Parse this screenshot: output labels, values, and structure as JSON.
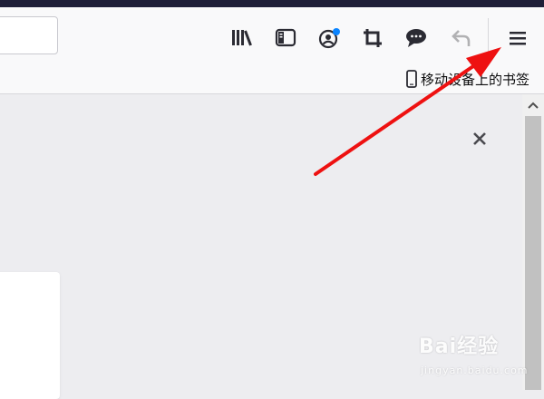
{
  "bookmarks_bar": {
    "mobile_bookmarks_label": "移动设备上的书签",
    "mobile_bookmarks_icon": "phone-icon"
  },
  "toolbar": {
    "icons": [
      "library-icon",
      "sidebar-icon",
      "account-icon",
      "screenshot-crop-icon",
      "chat-icon",
      "undo-icon",
      "hamburger-menu-icon"
    ],
    "notification_dot_color": "#0a84ff"
  },
  "annotation": {
    "arrow_color": "#ee1111"
  },
  "watermark": {
    "main_text": "Bai经验",
    "sub_text": "jingyan.baidu.com"
  }
}
